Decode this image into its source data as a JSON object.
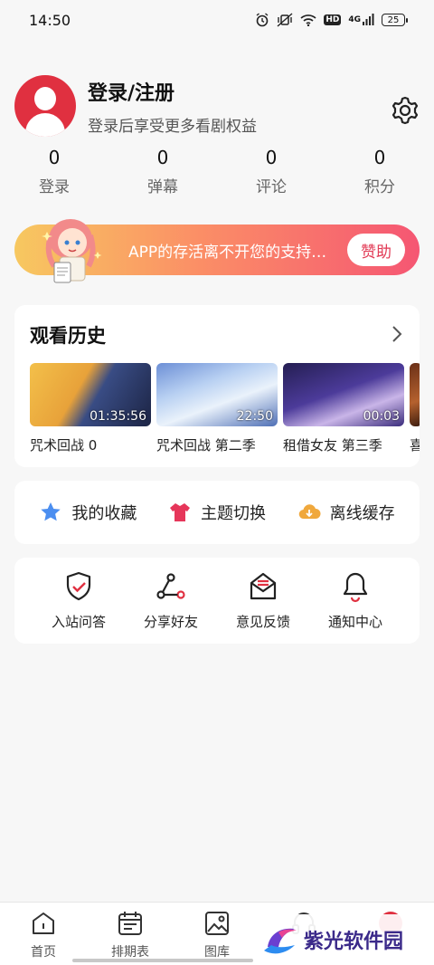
{
  "status_bar": {
    "time": "14:50",
    "network": "4G",
    "hd": "HD",
    "battery": "25"
  },
  "profile": {
    "title": "登录/注册",
    "subtitle": "登录后享受更多看剧权益"
  },
  "stats": [
    {
      "value": "0",
      "label": "登录"
    },
    {
      "value": "0",
      "label": "弹幕"
    },
    {
      "value": "0",
      "label": "评论"
    },
    {
      "value": "0",
      "label": "积分"
    }
  ],
  "banner": {
    "text": "APP的存活离不开您的支持…",
    "button": "赞助"
  },
  "history": {
    "title": "观看历史",
    "items": [
      {
        "title": "咒术回战 0",
        "time": "01:35:56"
      },
      {
        "title": "咒术回战 第二季",
        "time": "22:50"
      },
      {
        "title": "租借女友 第三季",
        "time": "00:03"
      },
      {
        "title": "喜",
        "time": ""
      }
    ]
  },
  "quick": [
    {
      "label": "我的收藏",
      "icon": "star-icon",
      "color": "#4b8ef0"
    },
    {
      "label": "主题切换",
      "icon": "shirt-icon",
      "color": "#e6365a"
    },
    {
      "label": "离线缓存",
      "icon": "cloud-download-icon",
      "color": "#f0a83c"
    }
  ],
  "tools": [
    {
      "label": "入站问答",
      "icon": "shield-check-icon"
    },
    {
      "label": "分享好友",
      "icon": "share-icon"
    },
    {
      "label": "意见反馈",
      "icon": "mail-icon"
    },
    {
      "label": "通知中心",
      "icon": "bell-icon"
    }
  ],
  "tabs": [
    {
      "label": "首页",
      "icon": "home-icon"
    },
    {
      "label": "排期表",
      "icon": "calendar-icon"
    },
    {
      "label": "图库",
      "icon": "gallery-icon"
    },
    {
      "label": "",
      "icon": "headphone-icon"
    },
    {
      "label": "",
      "icon": "profile-icon"
    }
  ],
  "watermark": {
    "text": "紫光软件园"
  },
  "colors": {
    "accent": "#e03040",
    "banner_start": "#f7c860",
    "banner_end": "#f55673"
  }
}
